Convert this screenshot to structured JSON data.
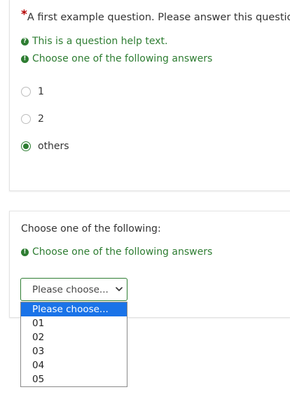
{
  "question1": {
    "required_mark": "*",
    "text": "A first example question. Please answer this question:",
    "help_text": "This is a question help text.",
    "tip_text": "Choose one of the following answers",
    "options": [
      {
        "label": "1",
        "checked": false
      },
      {
        "label": "2",
        "checked": false
      },
      {
        "label": "others",
        "checked": true
      }
    ]
  },
  "question2": {
    "text": "Choose one of the following:",
    "tip_text": "Choose one of the following answers",
    "select": {
      "value": "Please choose...",
      "options": [
        "Please choose...",
        "01",
        "02",
        "03",
        "04",
        "05"
      ],
      "highlighted_index": 0
    }
  },
  "colors": {
    "accent_green": "#2e7d32",
    "required_red": "#b30000",
    "highlight_blue": "#1a73e8"
  },
  "icons": {
    "help": "question-circle-icon",
    "tip": "exclamation-circle-icon",
    "select": "chevron-down-icon"
  }
}
